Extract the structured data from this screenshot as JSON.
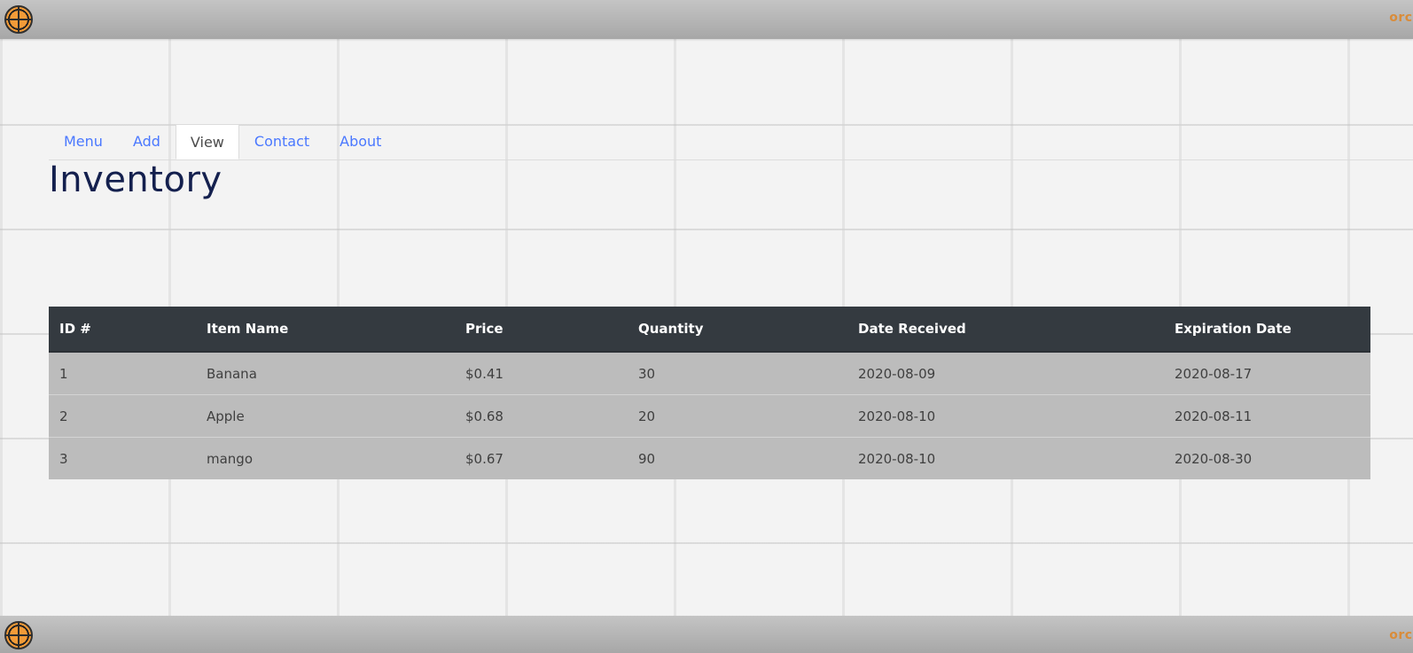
{
  "header": {
    "brand": "orch"
  },
  "nav": {
    "tabs": [
      {
        "label": "Menu"
      },
      {
        "label": "Add"
      },
      {
        "label": "View"
      },
      {
        "label": "Contact"
      },
      {
        "label": "About"
      }
    ],
    "active": "View"
  },
  "page": {
    "title": "Inventory"
  },
  "table": {
    "headers": {
      "id": "ID #",
      "name": "Item Name",
      "price": "Price",
      "quantity": "Quantity",
      "date_received": "Date Received",
      "expiration_date": "Expiration Date"
    },
    "rows": [
      {
        "id": "1",
        "name": "Banana",
        "price": "$0.41",
        "quantity": "30",
        "date_received": "2020-08-09",
        "expiration_date": "2020-08-17"
      },
      {
        "id": "2",
        "name": "Apple",
        "price": "$0.68",
        "quantity": "20",
        "date_received": "2020-08-10",
        "expiration_date": "2020-08-11"
      },
      {
        "id": "3",
        "name": "mango",
        "price": "$0.67",
        "quantity": "90",
        "date_received": "2020-08-10",
        "expiration_date": "2020-08-30"
      }
    ]
  },
  "footer": {
    "brand": "orch"
  },
  "colors": {
    "nav_link": "#4a78ff",
    "title": "#14204e",
    "table_header_bg": "#343a40",
    "table_row_bg": "#bcbcbc",
    "brand": "#d98c3a"
  },
  "icons": {
    "logo": "orange-slice-icon"
  }
}
